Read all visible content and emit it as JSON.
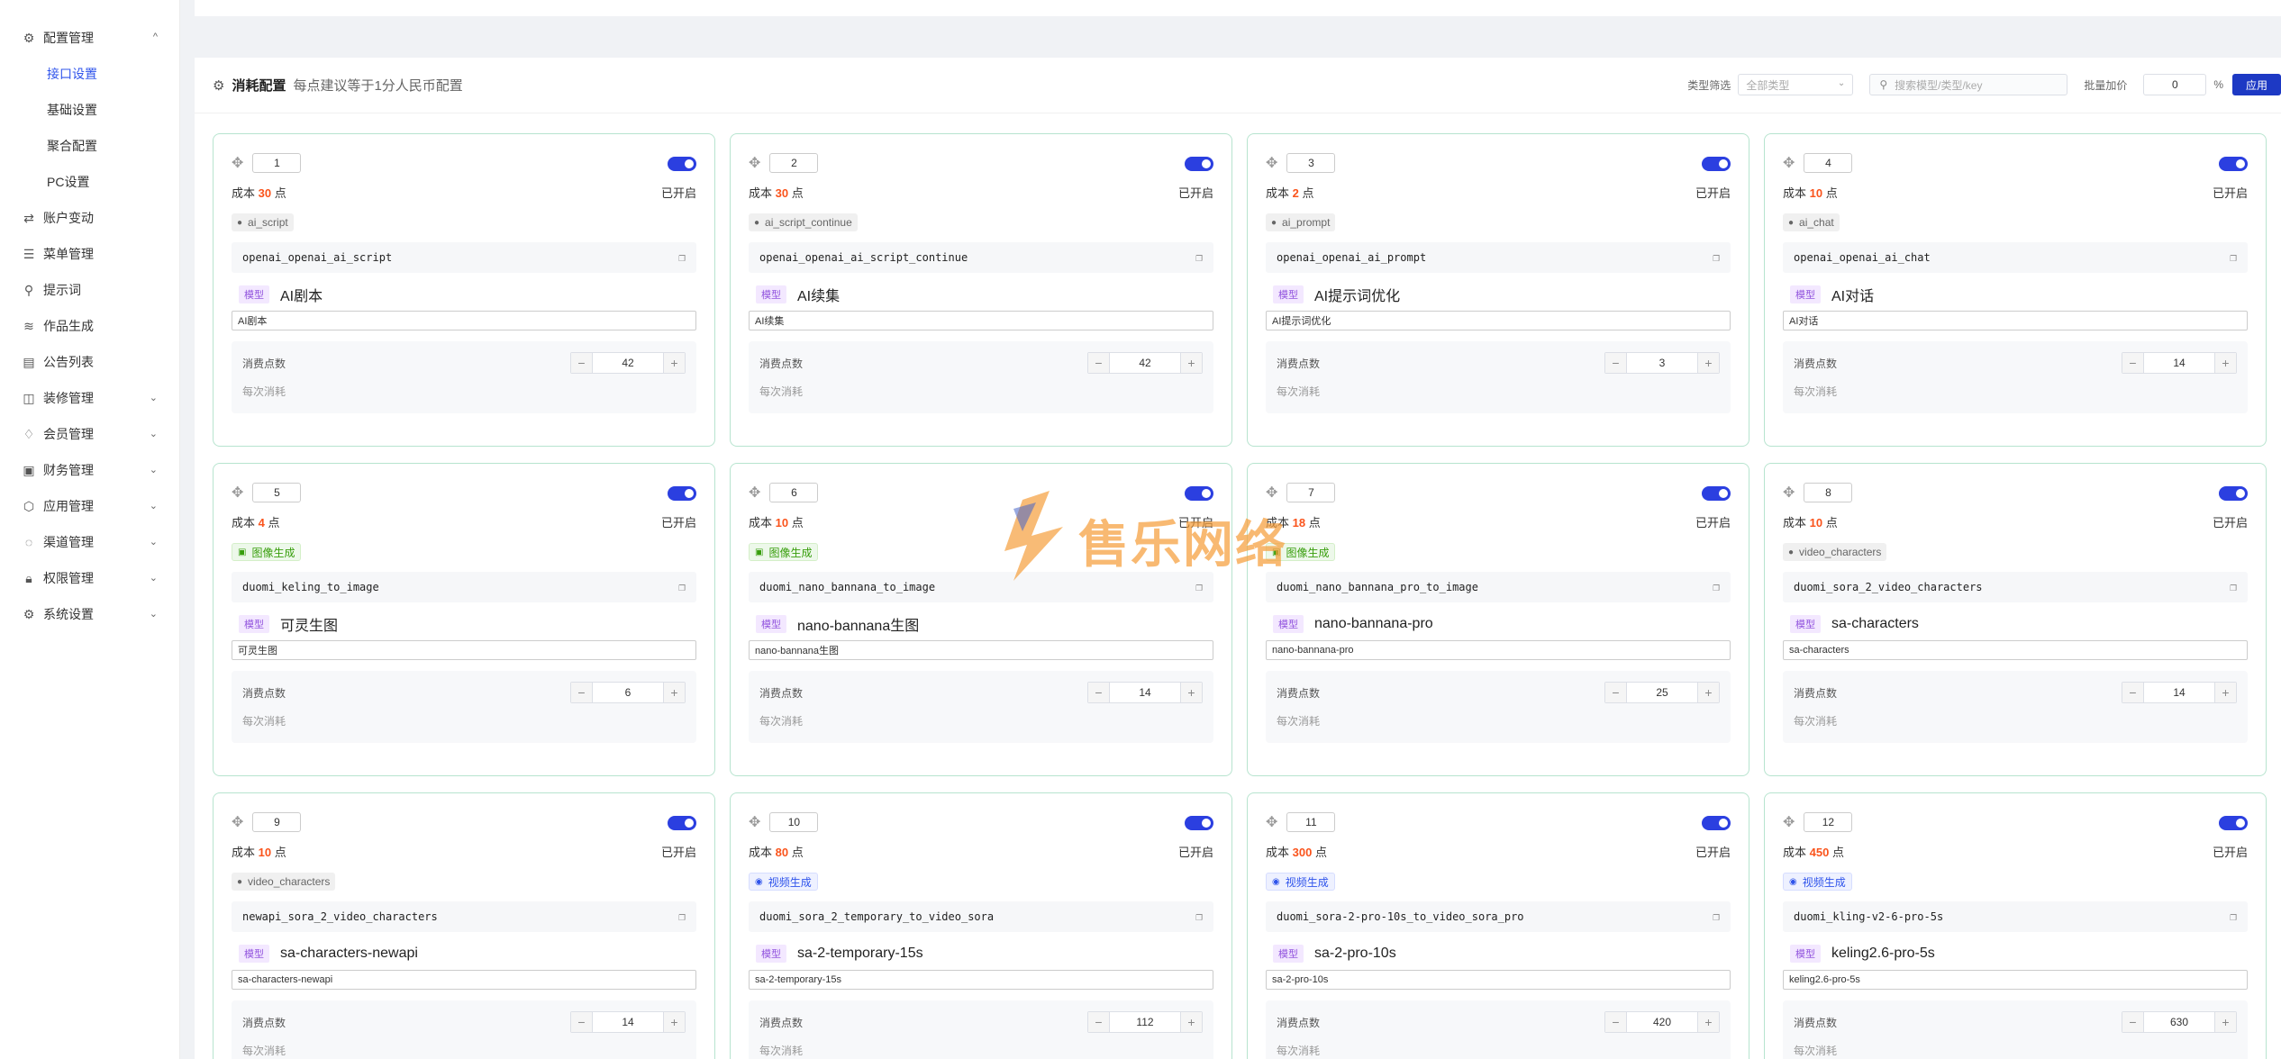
{
  "sidebar": {
    "top_group": {
      "label": "配置管理",
      "chevron": "^"
    },
    "sub_items": [
      {
        "label": "接口设置",
        "active": true
      },
      {
        "label": "基础设置",
        "active": false
      },
      {
        "label": "聚合配置",
        "active": false
      },
      {
        "label": "PC设置",
        "active": false
      }
    ],
    "items": [
      {
        "label": "账户变动",
        "icon": "swap-icon",
        "glyph": "⇄",
        "chevron": ""
      },
      {
        "label": "菜单管理",
        "icon": "menu-icon",
        "glyph": "☰",
        "chevron": ""
      },
      {
        "label": "提示词",
        "icon": "link-icon",
        "glyph": "⚲",
        "chevron": ""
      },
      {
        "label": "作品生成",
        "icon": "layers-icon",
        "glyph": "≋",
        "chevron": ""
      },
      {
        "label": "公告列表",
        "icon": "notice-icon",
        "glyph": "▤",
        "chevron": ""
      },
      {
        "label": "装修管理",
        "icon": "palette-icon",
        "glyph": "◫",
        "chevron": "⌄"
      },
      {
        "label": "会员管理",
        "icon": "vip-icon",
        "glyph": "♢",
        "chevron": "⌄"
      },
      {
        "label": "财务管理",
        "icon": "finance-icon",
        "glyph": "▣",
        "chevron": "⌄"
      },
      {
        "label": "应用管理",
        "icon": "app-icon",
        "glyph": "⬡",
        "chevron": "⌄"
      },
      {
        "label": "渠道管理",
        "icon": "channel-icon",
        "glyph": "◌",
        "chevron": "⌄"
      },
      {
        "label": "权限管理",
        "icon": "lock-icon",
        "glyph": "🔒︎",
        "chevron": "⌄"
      },
      {
        "label": "系统设置",
        "icon": "gear-icon",
        "glyph": "⚙",
        "chevron": "⌄"
      }
    ]
  },
  "header": {
    "title": "消耗配置",
    "subtitle": "每点建议等于1分人民币配置",
    "type_filter_label": "类型筛选",
    "type_filter_value": "全部类型",
    "search_placeholder": "搜索模型/类型/key",
    "batch_label": "批量加价",
    "batch_value": "0",
    "percent": "%",
    "apply_label": "应用"
  },
  "common": {
    "enabled": "已开启",
    "cost_prefix": "成本",
    "cost_suffix": "点",
    "model_badge": "模型",
    "consume_label": "消费点数",
    "consume_sub": "每次消耗"
  },
  "cards": [
    {
      "index": "1",
      "cost": "30",
      "tag": "ai_script",
      "tag_style": "gray",
      "key": "openai_openai_ai_script",
      "model": "AI剧本",
      "name": "AI剧本",
      "points": "42"
    },
    {
      "index": "2",
      "cost": "30",
      "tag": "ai_script_continue",
      "tag_style": "gray",
      "key": "openai_openai_ai_script_continue",
      "model": "AI续集",
      "name": "AI续集",
      "points": "42"
    },
    {
      "index": "3",
      "cost": "2",
      "tag": "ai_prompt",
      "tag_style": "gray",
      "key": "openai_openai_ai_prompt",
      "model": "AI提示词优化",
      "name": "AI提示词优化",
      "points": "3"
    },
    {
      "index": "4",
      "cost": "10",
      "tag": "ai_chat",
      "tag_style": "gray",
      "key": "openai_openai_ai_chat",
      "model": "AI对话",
      "name": "AI对话",
      "points": "14"
    },
    {
      "index": "5",
      "cost": "4",
      "tag": "图像生成",
      "tag_style": "green",
      "key": "duomi_keling_to_image",
      "model": "可灵生图",
      "name": "可灵生图",
      "points": "6"
    },
    {
      "index": "6",
      "cost": "10",
      "tag": "图像生成",
      "tag_style": "green",
      "key": "duomi_nano_bannana_to_image",
      "model": "nano-bannana生图",
      "name": "nano-bannana生图",
      "points": "14"
    },
    {
      "index": "7",
      "cost": "18",
      "tag": "图像生成",
      "tag_style": "green",
      "key": "duomi_nano_bannana_pro_to_image",
      "model": "nano-bannana-pro",
      "name": "nano-bannana-pro",
      "points": "25"
    },
    {
      "index": "8",
      "cost": "10",
      "tag": "video_characters",
      "tag_style": "gray",
      "key": "duomi_sora_2_video_characters",
      "model": "sa-characters",
      "name": "sa-characters",
      "points": "14"
    },
    {
      "index": "9",
      "cost": "10",
      "tag": "video_characters",
      "tag_style": "gray",
      "key": "newapi_sora_2_video_characters",
      "model": "sa-characters-newapi",
      "name": "sa-characters-newapi",
      "points": "14"
    },
    {
      "index": "10",
      "cost": "80",
      "tag": "视频生成",
      "tag_style": "blue",
      "key": "duomi_sora_2_temporary_to_video_sora",
      "model": "sa-2-temporary-15s",
      "name": "sa-2-temporary-15s",
      "points": "112"
    },
    {
      "index": "11",
      "cost": "300",
      "tag": "视频生成",
      "tag_style": "blue",
      "key": "duomi_sora-2-pro-10s_to_video_sora_pro",
      "model": "sa-2-pro-10s",
      "name": "sa-2-pro-10s",
      "points": "420"
    },
    {
      "index": "12",
      "cost": "450",
      "tag": "视频生成",
      "tag_style": "blue",
      "key": "duomi_kling-v2-6-pro-5s",
      "model": "keling2.6-pro-5s",
      "name": "keling2.6-pro-5s",
      "points": "630"
    }
  ],
  "watermark": {
    "text": "售乐网络"
  },
  "colors": {
    "accent": "#2f54eb",
    "cost": "#fa541c",
    "card_border": "#b7e4cf",
    "toggle_on": "#2b3fe0"
  }
}
